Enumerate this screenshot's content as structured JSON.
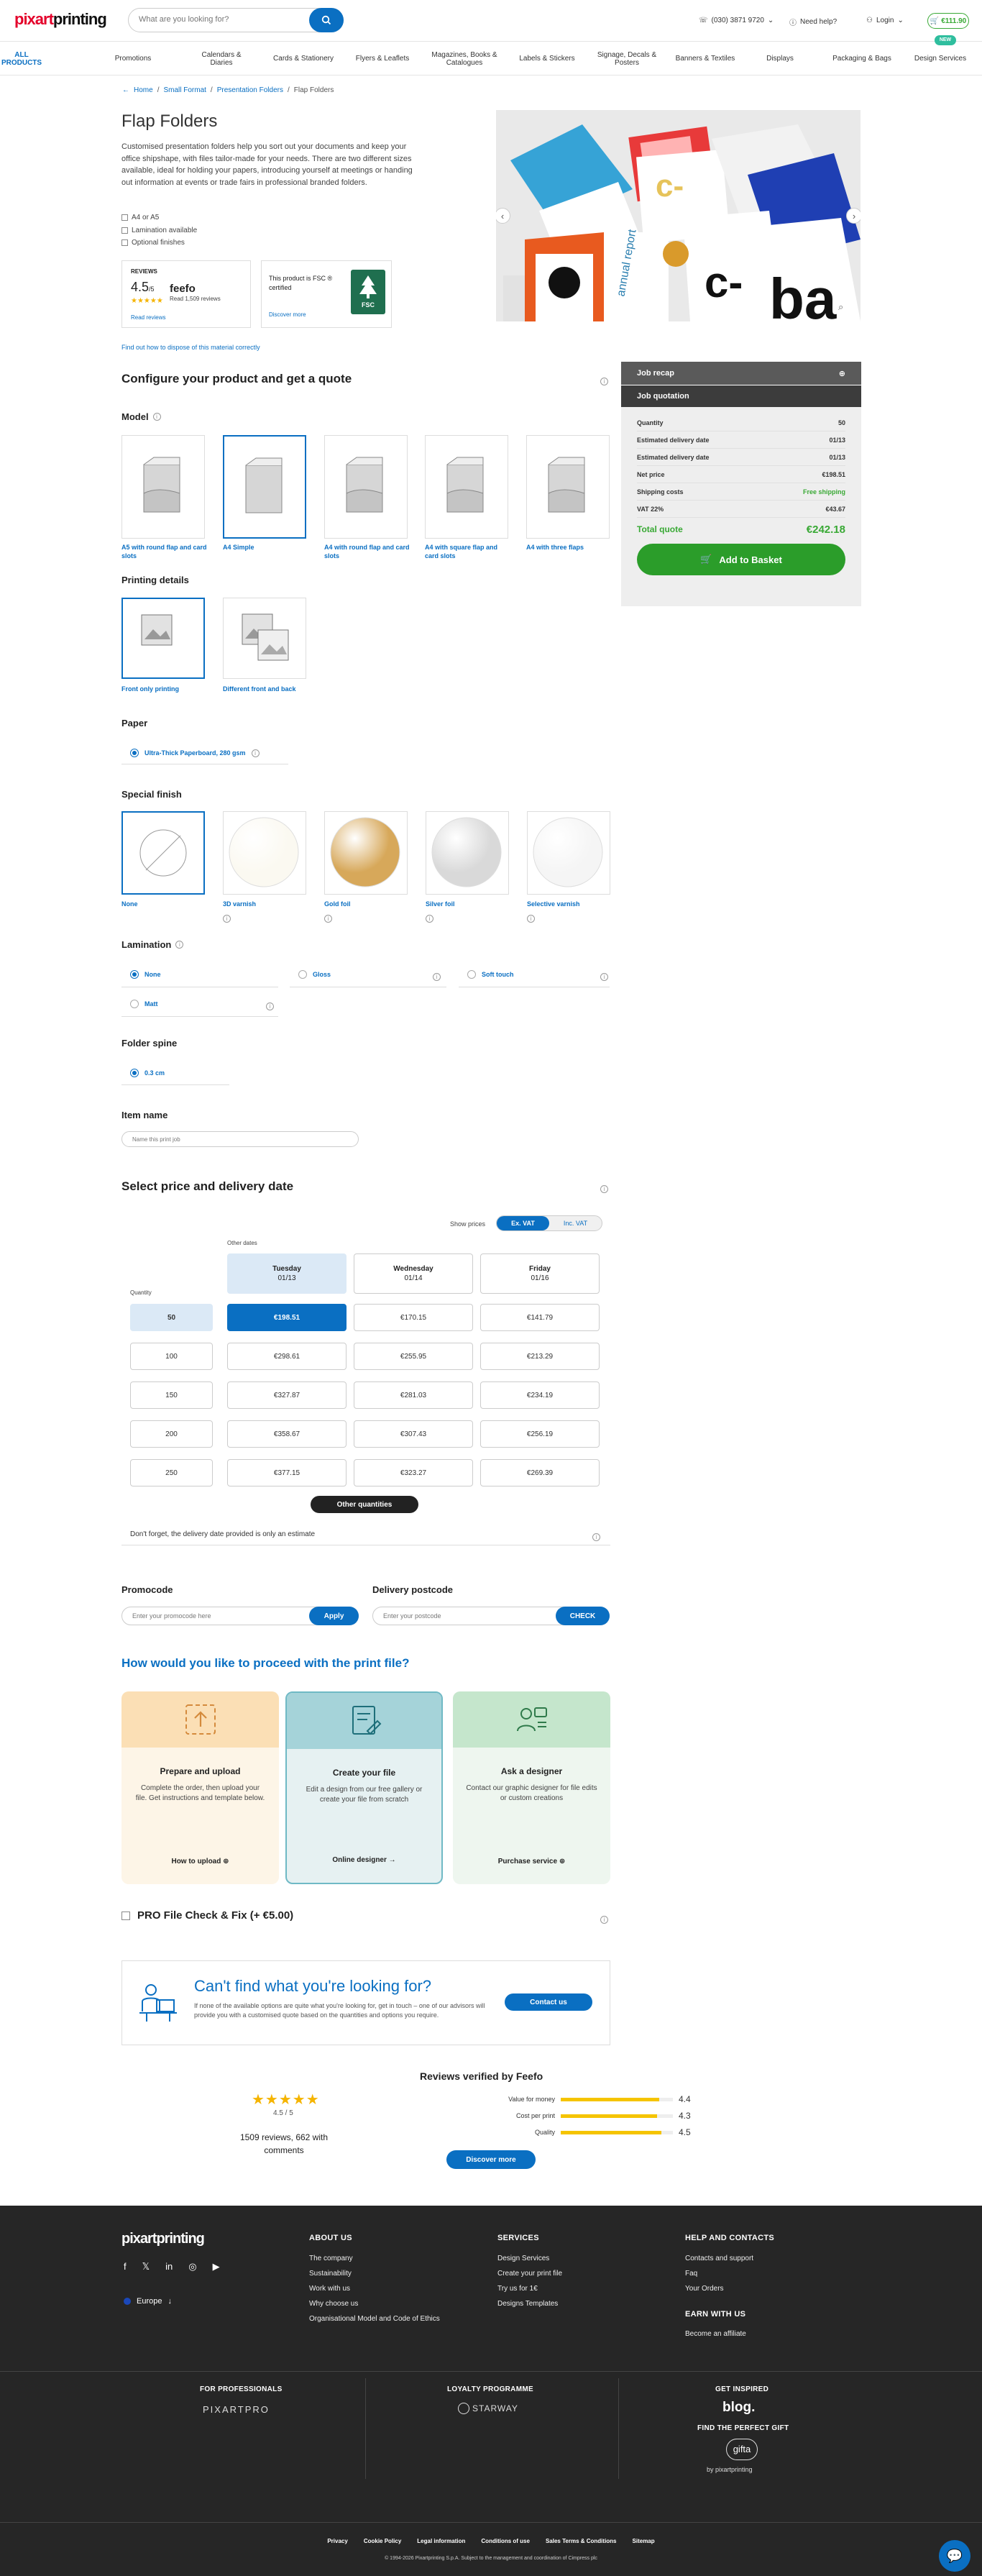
{
  "header": {
    "logo_part1": "pixart",
    "logo_part2": "printing",
    "search_placeholder": "What are you looking for?",
    "phone": "(030) 3871 9720",
    "help": "Need help?",
    "login": "Login",
    "cart_total": "€111.90",
    "new_badge": "NEW"
  },
  "nav": [
    "ALL PRODUCTS",
    "Promotions",
    "Calendars & Diaries",
    "Cards & Stationery",
    "Flyers & Leaflets",
    "Magazines, Books & Catalogues",
    "Labels & Stickers",
    "Signage, Decals & Posters",
    "Banners & Textiles",
    "Displays",
    "Packaging & Bags",
    "Design Services"
  ],
  "breadcrumb": [
    "Home",
    "Small Format",
    "Presentation Folders",
    "Flap Folders"
  ],
  "product": {
    "title": "Flap Folders",
    "description": "Customised presentation folders help you sort out your documents and keep your office shipshape, with files tailor-made for your needs. There are two different sizes available, ideal for holding your papers, introducing yourself at meetings or handing out information at events or trade fairs in professional branded folders.",
    "features": [
      "A4 or A5",
      "Lamination available",
      "Optional finishes"
    ],
    "reviews_label": "REVIEWS",
    "score": "4.5",
    "score_max": "/5",
    "feefo": "feefo",
    "read_reviews": "Read 1,509 reviews",
    "read_reviews_link": "Read reviews",
    "fsc_text": "This product is FSC ® certified",
    "discover": "Discover more",
    "dispose_link": "Find out how to dispose of this material correctly"
  },
  "configure": {
    "title": "Configure your product and get a quote",
    "model_title": "Model",
    "models": [
      "A5 with round flap and card slots",
      "A4 Simple",
      "A4 with round flap and card slots",
      "A4 with square flap and card slots",
      "A4 with three flaps"
    ],
    "printing_title": "Printing details",
    "printing": [
      "Front only printing",
      "Different front and back"
    ],
    "paper_title": "Paper",
    "paper": "Ultra-Thick Paperboard, 280 gsm",
    "finish_title": "Special finish",
    "finishes": [
      "None",
      "3D varnish",
      "Gold foil",
      "Silver foil",
      "Selective varnish"
    ],
    "lamination_title": "Lamination",
    "lamination": [
      "None",
      "Gloss",
      "Soft touch",
      "Matt"
    ],
    "spine_title": "Folder spine",
    "spine": "0.3 cm",
    "item_title": "Item name",
    "item_placeholder": "Name this print job"
  },
  "recap": {
    "title": "Job recap",
    "quotation": "Job quotation",
    "rows": [
      {
        "label": "Quantity",
        "value": "50"
      },
      {
        "label": "Estimated delivery date",
        "value": "01/13"
      },
      {
        "label": "Estimated delivery date",
        "value": "01/13"
      },
      {
        "label": "Net price",
        "value": "€198.51"
      },
      {
        "label": "Shipping costs",
        "value": "Free shipping"
      },
      {
        "label": "VAT 22%",
        "value": "€43.67"
      }
    ],
    "total_label": "Total quote",
    "total": "€242.18",
    "basket": "Add to Basket"
  },
  "pricing": {
    "title": "Select price and delivery date",
    "show_prices": "Show prices",
    "ex_vat": "Ex. VAT",
    "inc_vat": "Inc. VAT",
    "other_dates": "Other dates",
    "quantity_label": "Quantity",
    "days": [
      {
        "day": "Tuesday",
        "date": "01/13"
      },
      {
        "day": "Wednesday",
        "date": "01/14"
      },
      {
        "day": "Friday",
        "date": "01/16"
      }
    ],
    "rows": [
      {
        "qty": "50",
        "prices": [
          "€198.51",
          "€170.15",
          "€141.79"
        ]
      },
      {
        "qty": "100",
        "prices": [
          "€298.61",
          "€255.95",
          "€213.29"
        ]
      },
      {
        "qty": "150",
        "prices": [
          "€327.87",
          "€281.03",
          "€234.19"
        ]
      },
      {
        "qty": "200",
        "prices": [
          "€358.67",
          "€307.43",
          "€256.19"
        ]
      },
      {
        "qty": "250",
        "prices": [
          "€377.15",
          "€323.27",
          "€269.39"
        ]
      }
    ],
    "other_quantities": "Other quantities",
    "estimate_note": "Don't forget, the delivery date provided is only an estimate"
  },
  "promo": {
    "promo_title": "Promocode",
    "promo_placeholder": "Enter your promocode here",
    "apply": "Apply",
    "postcode_title": "Delivery postcode",
    "postcode_placeholder": "Enter your postcode",
    "check": "CHECK"
  },
  "proceed": {
    "title": "How would you like to proceed with the print file?",
    "cards": [
      {
        "title": "Prepare and upload",
        "desc": "Complete the order, then upload your file. Get instructions and template below.",
        "link": "How to upload"
      },
      {
        "title": "Create your file",
        "desc": "Edit a design from our free gallery or create your file from scratch",
        "link": "Online designer"
      },
      {
        "title": "Ask a designer",
        "desc": "Contact our graphic designer for file edits or custom creations",
        "link": "Purchase service"
      }
    ],
    "pro_check": "PRO File Check & Fix (+ €5.00)"
  },
  "cantfind": {
    "title": "Can't find what you're looking for?",
    "desc": "If none of the available options are quite what you're looking for, get in touch – one of our advisors will provide you with a customised quote based on the quantities and options you require.",
    "button": "Contact us"
  },
  "feefo_reviews": {
    "title": "Reviews verified by Feefo",
    "score": "4.5 / 5",
    "count": "1509 reviews, 662 with comments",
    "bars": [
      {
        "label": "Value for money",
        "value": 4.4
      },
      {
        "label": "Cost per print",
        "value": 4.3
      },
      {
        "label": "Quality",
        "value": 4.5
      }
    ],
    "button": "Discover more"
  },
  "footer": {
    "logo": "pixartprinting",
    "region": "Europe",
    "about_title": "ABOUT US",
    "about": [
      "The company",
      "Sustainability",
      "Work with us",
      "Why choose us",
      "Organisational Model and Code of Ethics"
    ],
    "services_title": "SERVICES",
    "services": [
      "Design Services",
      "Create your print file",
      "Try us for 1€",
      "Designs Templates"
    ],
    "help_title": "HELP AND CONTACTS",
    "help": [
      "Contacts and support",
      "Faq",
      "Your Orders"
    ],
    "earn_title": "EARN WITH US",
    "earn": [
      "Become an affiliate"
    ],
    "pro_title": "FOR PROFESSIONALS",
    "pro_logo": "PIXARTPRO",
    "loyalty_title": "LOYALTY PROGRAMME",
    "loyalty_logo": "STARWAY",
    "inspired_title": "GET INSPIRED",
    "blog": "blog.",
    "gift_title": "FIND THE PERFECT GIFT",
    "gift_logo": "gifta",
    "gift_by": "by pixartprinting",
    "legal": [
      "Privacy",
      "Cookie Policy",
      "Legal information",
      "Conditions of use",
      "Sales Terms & Conditions",
      "Sitemap"
    ],
    "copyright": "© 1994-2026 Pixartprinting S.p.A. Subject to the management and coordination of Cimpress plc"
  },
  "colors": {
    "brand_blue": "#0a6fc2",
    "brand_red": "#e4002b",
    "green": "#39a935",
    "footer_bg": "#262626"
  }
}
